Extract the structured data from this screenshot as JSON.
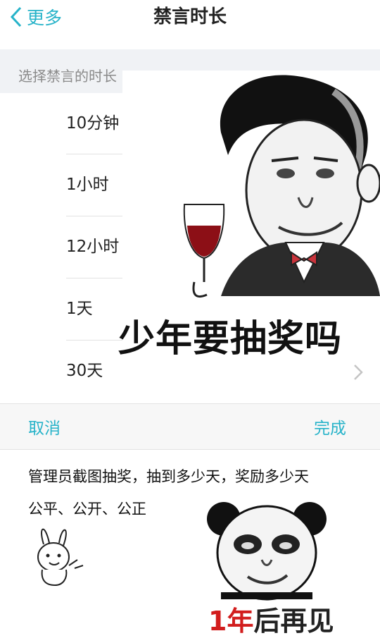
{
  "nav": {
    "back_label": "更多",
    "title": "禁言时长"
  },
  "sheet": {
    "header": "选择禁言的时长",
    "options": [
      "10分钟",
      "1小时",
      "12小时",
      "1天",
      "30天"
    ]
  },
  "actions": {
    "cancel": "取消",
    "done": "完成"
  },
  "caption": {
    "line1": "管理员截图抽奖，抽到多少天，奖励多少天",
    "line2": "公平、公开、公正"
  },
  "memes": {
    "top_caption": "少年要抽奖吗",
    "panda_red": "1年",
    "panda_black": "后再见"
  },
  "colors": {
    "accent": "#27b3c9",
    "header_bg": "#f0f2f5",
    "panda_red": "#d21d1d"
  }
}
